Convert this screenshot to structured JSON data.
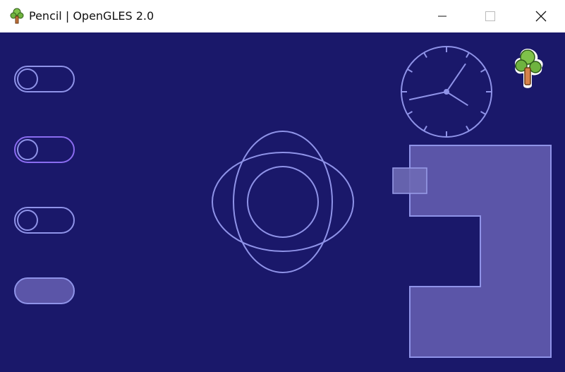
{
  "window": {
    "title": "Pencil | OpenGLES 2.0",
    "app_icon": "tree-icon",
    "controls": {
      "minimize": "minimize-icon",
      "maximize": "maximize-icon",
      "close": "close-icon"
    }
  },
  "toggles": [
    {
      "id": "toggle-1",
      "state": "off"
    },
    {
      "id": "toggle-2",
      "state": "off"
    },
    {
      "id": "toggle-3",
      "state": "off"
    },
    {
      "id": "toggle-4",
      "state": "blank"
    }
  ],
  "clock": {
    "hour": 4,
    "minute": 5,
    "second": 43
  },
  "colors": {
    "background": "#1a186a",
    "stroke": "#8f93e8",
    "toggle_active": "#8a6cf0",
    "fill": "#5b55a8"
  },
  "footer": {
    "text": ""
  }
}
